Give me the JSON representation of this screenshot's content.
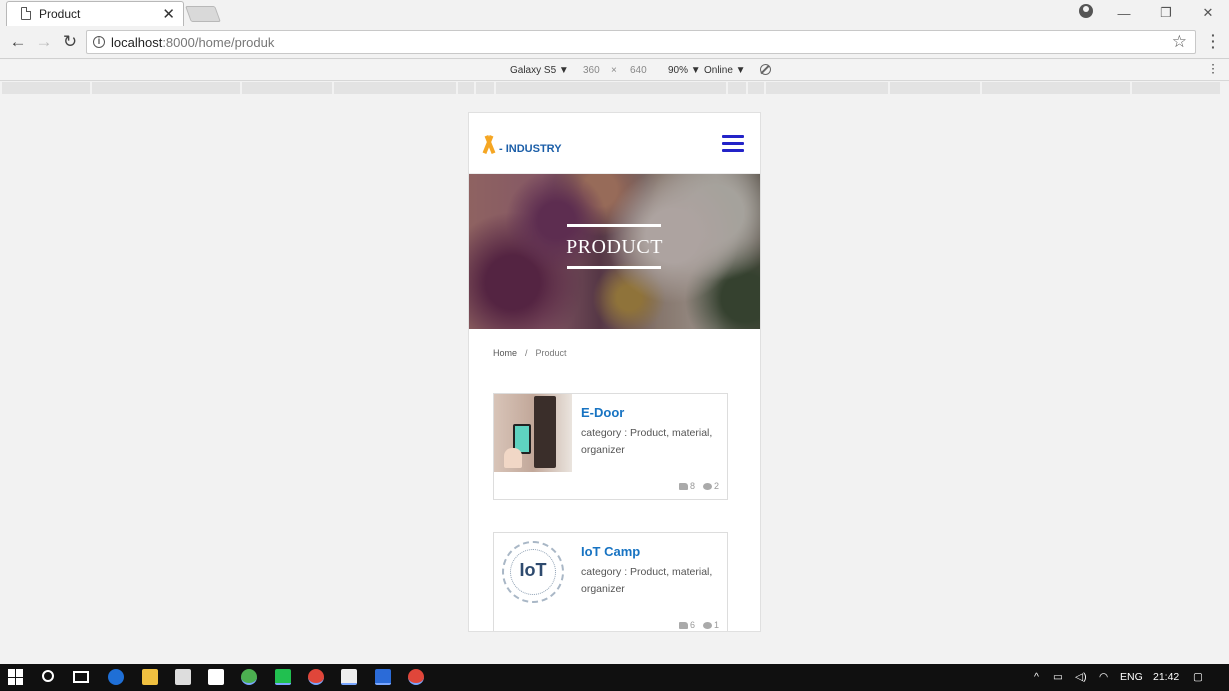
{
  "browser": {
    "tab_title": "Product",
    "tab_close": "✕",
    "url_host": "localhost",
    "url_path": ":8000/home/produk",
    "window_controls": [
      "—",
      "❐",
      "✕"
    ]
  },
  "device_toolbar": {
    "device": "Galaxy S5 ▼",
    "width": "360",
    "times": "×",
    "height": "640",
    "zoom": "90% ▼",
    "network": "Online ▼"
  },
  "site": {
    "logo_text": "- INDUSTRY",
    "hero_title": "PRODUCT",
    "breadcrumb": {
      "home": "Home",
      "separator": "/",
      "current": "Product"
    },
    "products": [
      {
        "title": "E-Door",
        "category": "category : Product, material, organizer",
        "likes": "8",
        "comments": "2",
        "thumb": "door-lock-image"
      },
      {
        "title": "IoT Camp",
        "category": "category : Product, material, organizer",
        "likes": "6",
        "comments": "1",
        "thumb": "iot-logo-image"
      }
    ]
  },
  "taskbar": {
    "language": "ENG",
    "time": "21:42"
  },
  "colors": {
    "accent_blue": "#1773c2",
    "logo_orange": "#f5a623",
    "hamburger_blue": "#2323c8"
  }
}
